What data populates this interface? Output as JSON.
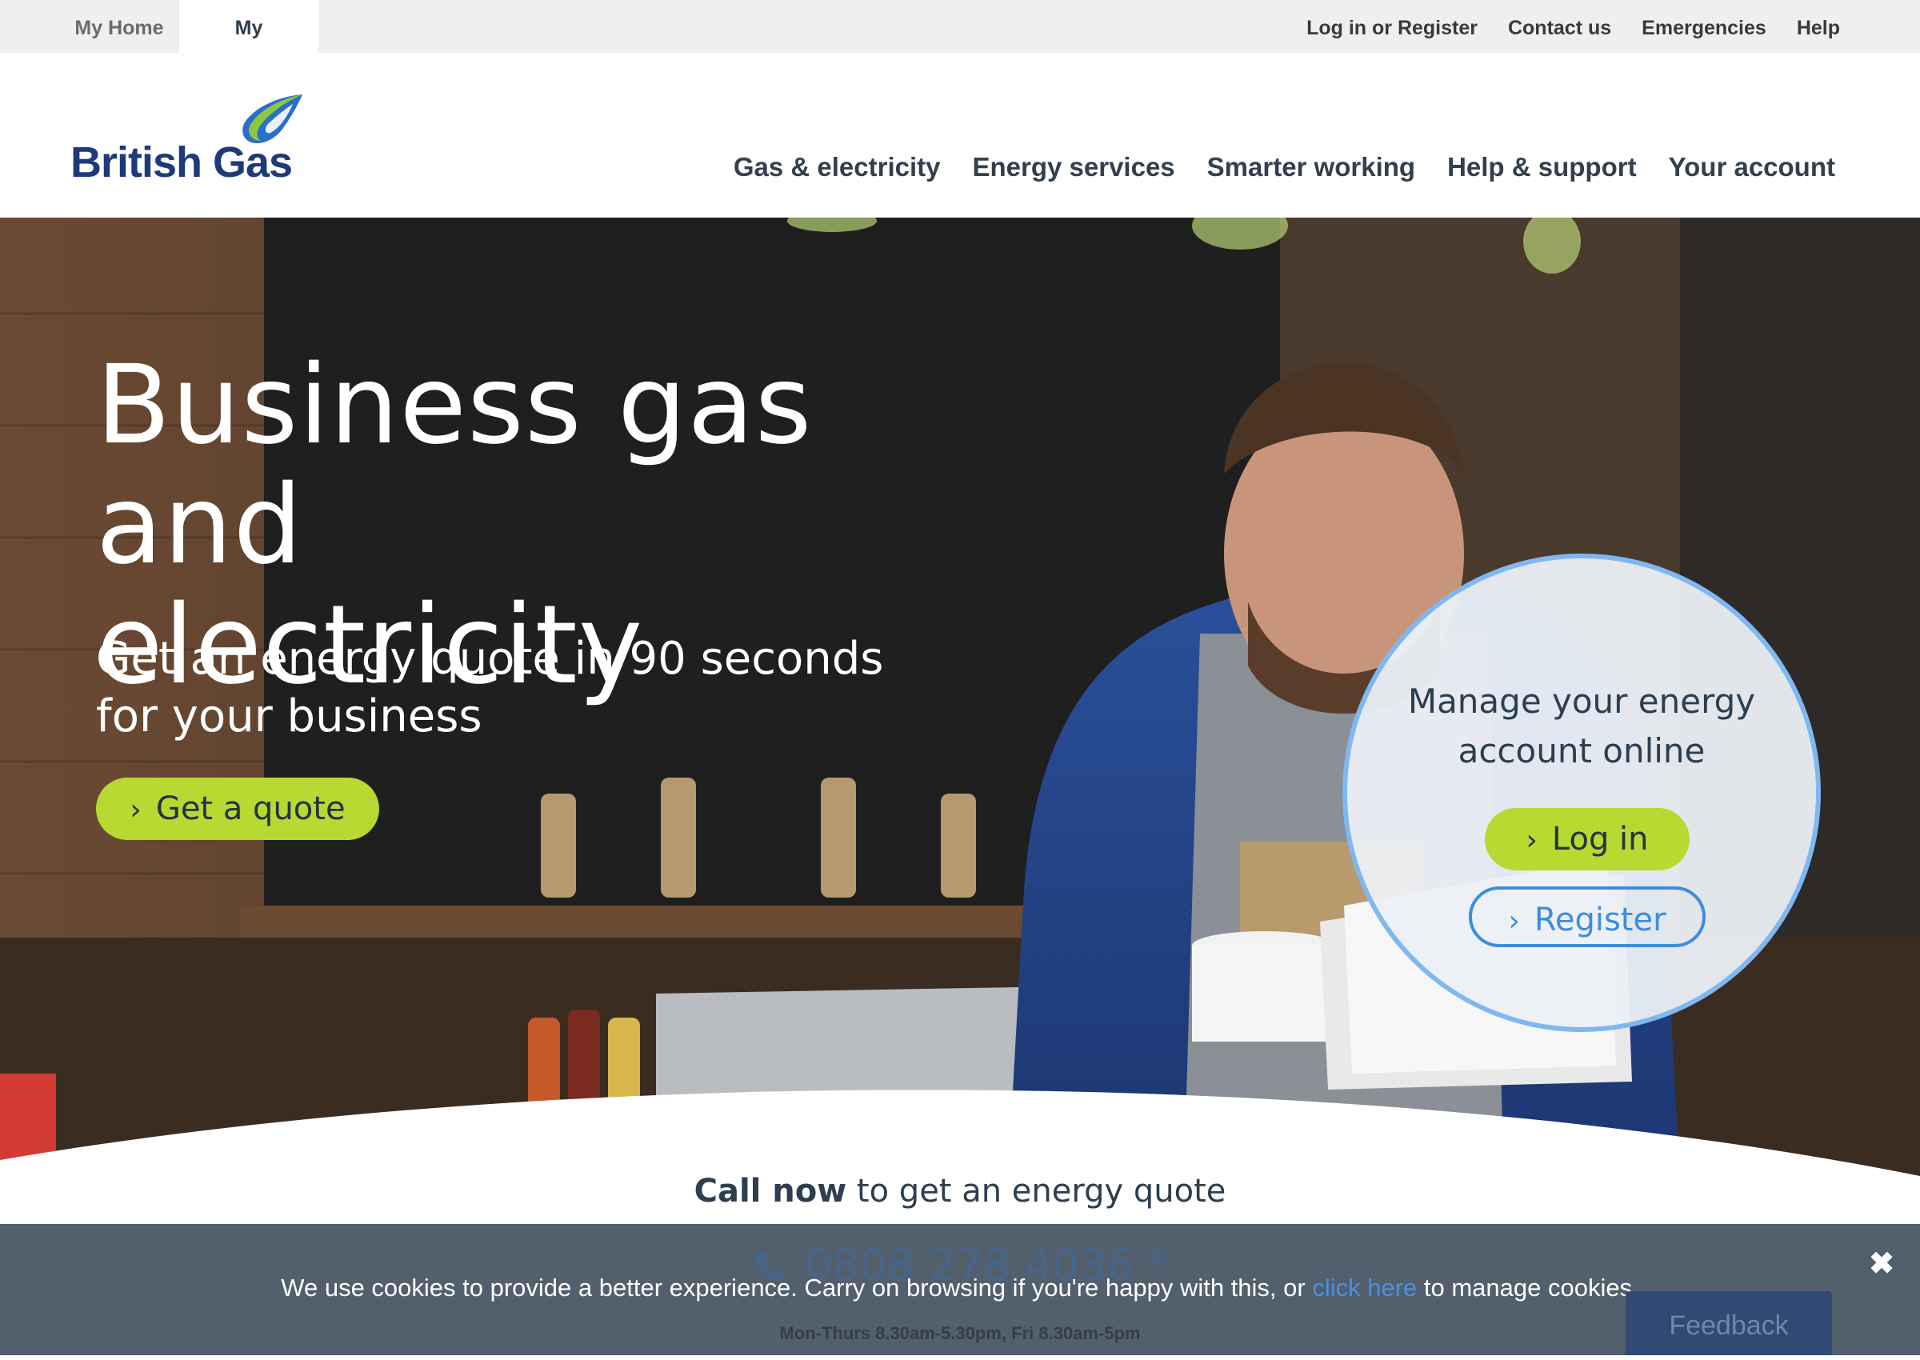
{
  "utility_bar": {
    "tabs": [
      {
        "label": "My Home",
        "active": false
      },
      {
        "label": "My Business",
        "active": true
      }
    ],
    "links": [
      "Log in or Register",
      "Contact us",
      "Emergencies",
      "Help"
    ]
  },
  "header": {
    "logo_text": "British Gas",
    "nav": [
      "Gas & electricity",
      "Energy services",
      "Smarter working",
      "Help & support",
      "Your account"
    ]
  },
  "hero": {
    "title_line1": "Business gas and",
    "title_line2": "electricity",
    "subtitle": "Get an energy quote in 90 seconds for your business",
    "cta_label": "Get a quote"
  },
  "account_panel": {
    "heading": "Manage your energy account online",
    "login_label": "Log in",
    "register_label": "Register"
  },
  "call_section": {
    "emphasis": "Call now",
    "text": " to get an energy quote",
    "phone": "0808 278 4036 *",
    "hours": "Mon-Thurs 8.30am-5.30pm, Fri 8.30am-5pm"
  },
  "cookie_bar": {
    "message_before": "We use cookies to provide a better experience. Carry on browsing if you're happy with this, or ",
    "link_text": "click here",
    "message_after": " to manage cookies.",
    "close_symbol": "✖"
  },
  "feedback": {
    "label": "Feedback"
  },
  "colors": {
    "brand_navy": "#1f3a7a",
    "accent_green": "#b8d832",
    "accent_blue": "#3c8dde",
    "cookie_bg": "#495665"
  },
  "icons": [
    "chevron-right-icon",
    "phone-icon",
    "close-icon",
    "british-gas-flame-icon"
  ]
}
